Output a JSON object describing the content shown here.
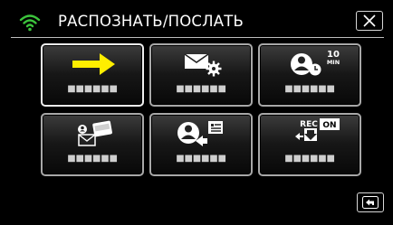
{
  "header": {
    "title": "РАСПОЗНАТЬ/ПОСЛАТЬ",
    "status_icon": "wifi-icon",
    "close_icon": "close-icon"
  },
  "tiles": [
    {
      "icon": "arrow-right-icon",
      "label": "■■■■■■"
    },
    {
      "icon": "mail-settings-icon",
      "label": "■■■■■■"
    },
    {
      "icon": "person-clock-icon",
      "badge": "10\nMIN",
      "badge_top": "10",
      "badge_bottom": "MIN",
      "label": "■■■■■■"
    },
    {
      "icon": "mail-camera-icon",
      "label": "■■■■■■"
    },
    {
      "icon": "person-send-picture-icon",
      "label": "■■■■■■"
    },
    {
      "icon": "rec-transfer-icon",
      "badge_rec": "REC",
      "badge_on": "ON",
      "label": "■■■■■■"
    }
  ],
  "footer": {
    "back_icon": "back-icon"
  },
  "colors": {
    "background": "#000000",
    "wifi": "#3cc43c",
    "arrow": "#ffee00",
    "tile_border": "#a8a8a8"
  }
}
